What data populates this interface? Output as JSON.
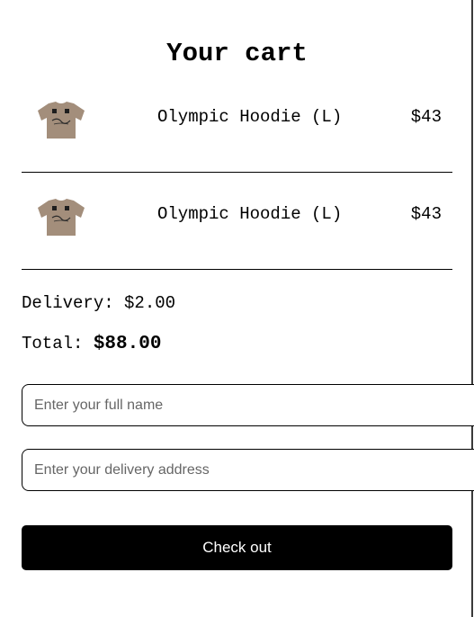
{
  "cart": {
    "title": "Your cart",
    "items": [
      {
        "name": "Olympic Hoodie (L)",
        "price": "$43",
        "image_icon": "tshirt-thumbnail"
      },
      {
        "name": "Olympic Hoodie (L)",
        "price": "$43",
        "image_icon": "tshirt-thumbnail"
      }
    ],
    "delivery_label": "Delivery:",
    "delivery_value": "$2.00",
    "total_label": "Total:",
    "total_value": "$88.00"
  },
  "form": {
    "name_placeholder": "Enter your full name",
    "name_value": "",
    "address_placeholder": "Enter your delivery address",
    "address_value": "",
    "checkout_label": "Check out"
  },
  "colors": {
    "product_tan": "#a38e7b",
    "button_bg": "#000000",
    "button_text": "#ffffff"
  }
}
